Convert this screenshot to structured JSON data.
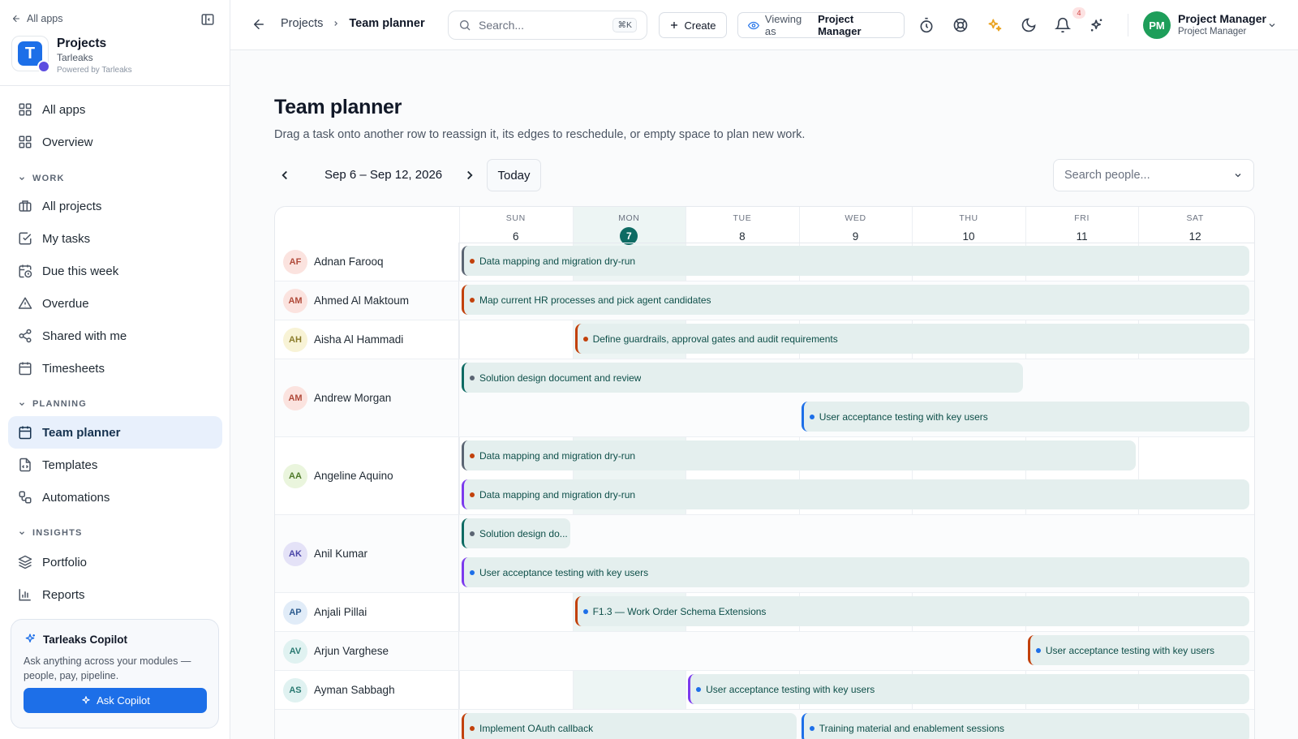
{
  "sidebar": {
    "back_label": "All apps",
    "app_name": "Projects",
    "app_logo_letter": "T",
    "org_name": "Tarleaks",
    "powered_by": "Powered by Tarleaks",
    "top_items": [
      {
        "label": "All apps",
        "icon": "grid-icon"
      },
      {
        "label": "Overview",
        "icon": "grid-icon"
      }
    ],
    "sections": [
      {
        "label": "WORK",
        "items": [
          {
            "label": "All projects",
            "icon": "briefcase-icon"
          },
          {
            "label": "My tasks",
            "icon": "check-square-icon"
          },
          {
            "label": "Due this week",
            "icon": "calendar-clock-icon"
          },
          {
            "label": "Overdue",
            "icon": "warning-icon"
          },
          {
            "label": "Shared with me",
            "icon": "share-icon"
          },
          {
            "label": "Timesheets",
            "icon": "calendar-icon"
          }
        ]
      },
      {
        "label": "PLANNING",
        "items": [
          {
            "label": "Team planner",
            "icon": "calendar-icon",
            "active": true
          },
          {
            "label": "Templates",
            "icon": "file-icon"
          },
          {
            "label": "Automations",
            "icon": "workflow-icon"
          }
        ]
      },
      {
        "label": "INSIGHTS",
        "items": [
          {
            "label": "Portfolio",
            "icon": "layers-icon"
          },
          {
            "label": "Reports",
            "icon": "bar-chart-icon"
          }
        ]
      }
    ],
    "copilot": {
      "title": "Tarleaks Copilot",
      "description": "Ask anything across your modules — people, pay, pipeline.",
      "button_label": "Ask Copilot"
    }
  },
  "topbar": {
    "breadcrumb": [
      "Projects",
      "Team planner"
    ],
    "search_placeholder": "Search...",
    "search_shortcut": "⌘K",
    "create_label": "Create",
    "viewing_label": "Viewing as",
    "viewing_role": "Project Manager",
    "notification_count": "4",
    "user": {
      "initials": "PM",
      "name": "Project Manager",
      "role": "Project Manager"
    }
  },
  "page": {
    "title": "Team planner",
    "subtitle": "Drag a task onto another row to reassign it, its edges to reschedule, or empty space to plan new work.",
    "week_range": "Sep 6 – Sep 12, 2026",
    "today_label": "Today",
    "people_search_placeholder": "Search people..."
  },
  "colors": {
    "accent": "#1d6fe8",
    "teal": "#0e6b63",
    "task_bg": "#e4efee",
    "today_bg": "#edf5f4"
  },
  "planner": {
    "days": [
      {
        "dow": "SUN",
        "num": "6"
      },
      {
        "dow": "MON",
        "num": "7",
        "today": true
      },
      {
        "dow": "TUE",
        "num": "8"
      },
      {
        "dow": "WED",
        "num": "9"
      },
      {
        "dow": "THU",
        "num": "10"
      },
      {
        "dow": "FRI",
        "num": "11"
      },
      {
        "dow": "SAT",
        "num": "12"
      }
    ],
    "people": [
      {
        "initials": "AF",
        "name": "Adnan Farooq",
        "avatar_bg": "#fbe3df",
        "avatar_fg": "#b04a3a",
        "tasks": [
          {
            "title": "Data mapping and migration dry-run",
            "start": 0,
            "end": 6,
            "lane": 0,
            "bar": "#5b6573",
            "dot": "#c2410c"
          }
        ]
      },
      {
        "initials": "AM",
        "name": "Ahmed Al Maktoum",
        "avatar_bg": "#fbe3df",
        "avatar_fg": "#b04a3a",
        "tasks": [
          {
            "title": "Map current HR processes and pick agent candidates",
            "start": 0,
            "end": 6,
            "lane": 0,
            "bar": "#c2410c",
            "dot": "#c2410c"
          }
        ]
      },
      {
        "initials": "AH",
        "name": "Aisha Al Hammadi",
        "avatar_bg": "#f8f3d6",
        "avatar_fg": "#8a7b2a",
        "tasks": [
          {
            "title": "Define guardrails, approval gates and audit requirements",
            "start": 1,
            "end": 6,
            "lane": 0,
            "bar": "#c2410c",
            "dot": "#c2410c"
          }
        ]
      },
      {
        "initials": "AM",
        "name": "Andrew Morgan",
        "avatar_bg": "#fbe3df",
        "avatar_fg": "#b04a3a",
        "tasks": [
          {
            "title": "Solution design document and review",
            "start": 0,
            "end": 4,
            "lane": 0,
            "bar": "#0e6b63",
            "dot": "#5b6573"
          },
          {
            "title": "User acceptance testing with key users",
            "start": 3,
            "end": 6,
            "lane": 1,
            "bar": "#1d6fe8",
            "dot": "#1d6fe8"
          }
        ]
      },
      {
        "initials": "AA",
        "name": "Angeline Aquino",
        "avatar_bg": "#eaf5dd",
        "avatar_fg": "#4f7a2a",
        "tasks": [
          {
            "title": "Data mapping and migration dry-run",
            "start": 0,
            "end": 5,
            "lane": 0,
            "bar": "#5b6573",
            "dot": "#c2410c"
          },
          {
            "title": "Data mapping and migration dry-run",
            "start": 0,
            "end": 6,
            "lane": 1,
            "bar": "#7c3aed",
            "dot": "#c2410c"
          }
        ]
      },
      {
        "initials": "AK",
        "name": "Anil Kumar",
        "avatar_bg": "#e4e2f7",
        "avatar_fg": "#4b46a8",
        "tasks": [
          {
            "title": "Solution design do...",
            "start": 0,
            "end": 0,
            "lane": 0,
            "bar": "#0e6b63",
            "dot": "#5b6573"
          },
          {
            "title": "User acceptance testing with key users",
            "start": 0,
            "end": 6,
            "lane": 1,
            "bar": "#7c3aed",
            "dot": "#1d6fe8"
          }
        ]
      },
      {
        "initials": "AP",
        "name": "Anjali Pillai",
        "avatar_bg": "#e1ecf8",
        "avatar_fg": "#2d5c8f",
        "tasks": [
          {
            "title": "F1.3 — Work Order Schema Extensions",
            "start": 1,
            "end": 6,
            "lane": 0,
            "bar": "#c2410c",
            "dot": "#1d6fe8"
          }
        ]
      },
      {
        "initials": "AV",
        "name": "Arjun Varghese",
        "avatar_bg": "#e0f2f1",
        "avatar_fg": "#2a7a72",
        "tasks": [
          {
            "title": "User acceptance testing with key users",
            "start": 5,
            "end": 6,
            "lane": 0,
            "bar": "#c2410c",
            "dot": "#1d6fe8"
          }
        ]
      },
      {
        "initials": "AS",
        "name": "Ayman Sabbagh",
        "avatar_bg": "#e0f2f1",
        "avatar_fg": "#2a7a72",
        "tasks": [
          {
            "title": "User acceptance testing with key users",
            "start": 2,
            "end": 6,
            "lane": 0,
            "bar": "#7c3aed",
            "dot": "#1d6fe8"
          }
        ]
      },
      {
        "initials": "",
        "name": "",
        "avatar_bg": "#ffffff",
        "avatar_fg": "#ffffff",
        "tasks": [
          {
            "title": "Implement OAuth callback",
            "start": 0,
            "end": 2,
            "lane": 0,
            "bar": "#c2410c",
            "dot": "#c2410c"
          },
          {
            "title": "Training material and enablement sessions",
            "start": 3,
            "end": 6,
            "lane": 0,
            "bar": "#1d6fe8",
            "dot": "#1d6fe8"
          }
        ]
      }
    ]
  }
}
